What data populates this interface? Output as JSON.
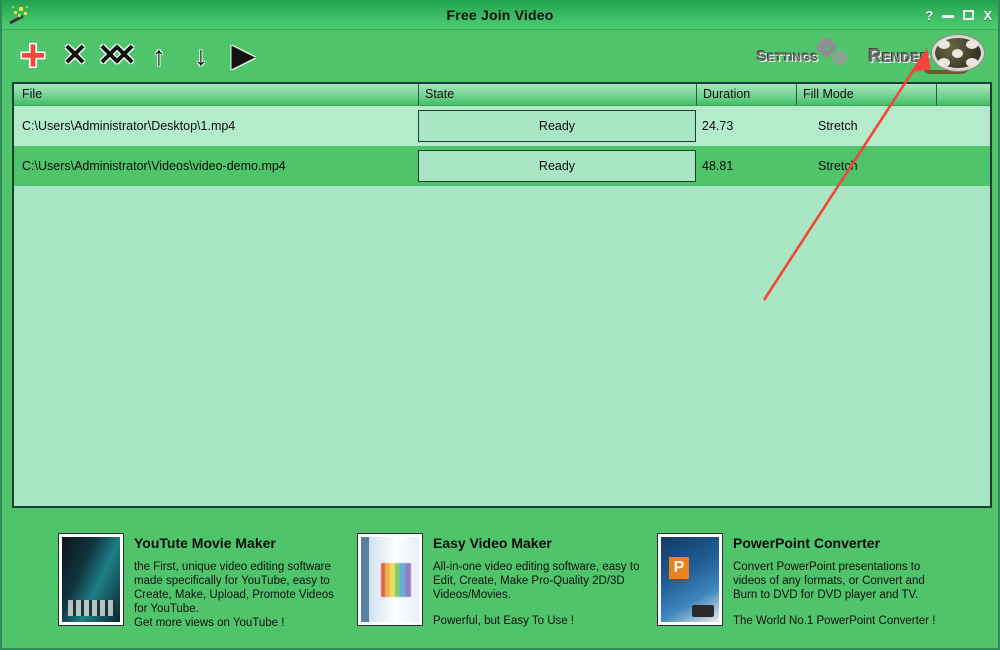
{
  "window": {
    "title": "Free Join Video",
    "app_icon": "magic-wand-icon",
    "controls": {
      "help": "?",
      "minimize": "minimize-icon",
      "maximize": "maximize-icon",
      "close": "X"
    }
  },
  "toolbar": {
    "buttons": [
      {
        "name": "add-file",
        "glyph": "+"
      },
      {
        "name": "remove-file",
        "glyph": "✕"
      },
      {
        "name": "remove-all-files",
        "glyph": "✕✕"
      },
      {
        "name": "move-up",
        "glyph": "↑"
      },
      {
        "name": "move-down",
        "glyph": "↓"
      },
      {
        "name": "preview-play",
        "glyph": "▶"
      }
    ],
    "settings_label": "Settings",
    "render_label": "Render"
  },
  "file_list": {
    "columns": [
      {
        "key": "file",
        "label": "File"
      },
      {
        "key": "state",
        "label": "State"
      },
      {
        "key": "duration",
        "label": "Duration"
      },
      {
        "key": "fill_mode",
        "label": "Fill Mode"
      },
      {
        "key": "end",
        "label": ""
      }
    ],
    "rows": [
      {
        "file": "C:\\Users\\Administrator\\Desktop\\1.mp4",
        "state": "Ready",
        "duration": "24.73",
        "fill_mode": "Stretch",
        "selected": false
      },
      {
        "file": "C:\\Users\\Administrator\\Videos\\video-demo.mp4",
        "state": "Ready",
        "duration": "48.81",
        "fill_mode": "Stretch",
        "selected": true
      }
    ]
  },
  "promos": [
    {
      "title": "YouTute Movie Maker",
      "desc": "the First, unique video editing software\nmade specifically for YouTube, easy to\nCreate, Make, Upload, Promote Videos\nfor YouTube.",
      "tagline": "Get more views on YouTube !",
      "box_art": "youtube-movie-maker-box"
    },
    {
      "title": "Easy Video Maker",
      "desc": "All-in-one video editing software, easy to\nEdit, Create, Make Pro-Quality 2D/3D\nVideos/Movies.",
      "tagline": "Powerful, but Easy To Use !",
      "box_art": "easy-video-maker-box"
    },
    {
      "title": "PowerPoint Converter",
      "desc": "Convert PowerPoint presentations to\nvideos of any formats, or Convert and\nBurn to DVD for DVD player and TV.",
      "tagline": "The World No.1 PowerPoint Converter !",
      "box_art": "powerpoint-converter-box"
    }
  ],
  "annotation": {
    "type": "red-arrow",
    "points_to": "render-button",
    "color": "#F4453C"
  },
  "colors": {
    "window_bg": "#4FC46A",
    "list_bg": "#A8E6C4",
    "row_alt": "#B3EBCB",
    "row_selected": "#4FC46A",
    "border": "#1d3f33",
    "accent_red": "#F04A3C"
  }
}
